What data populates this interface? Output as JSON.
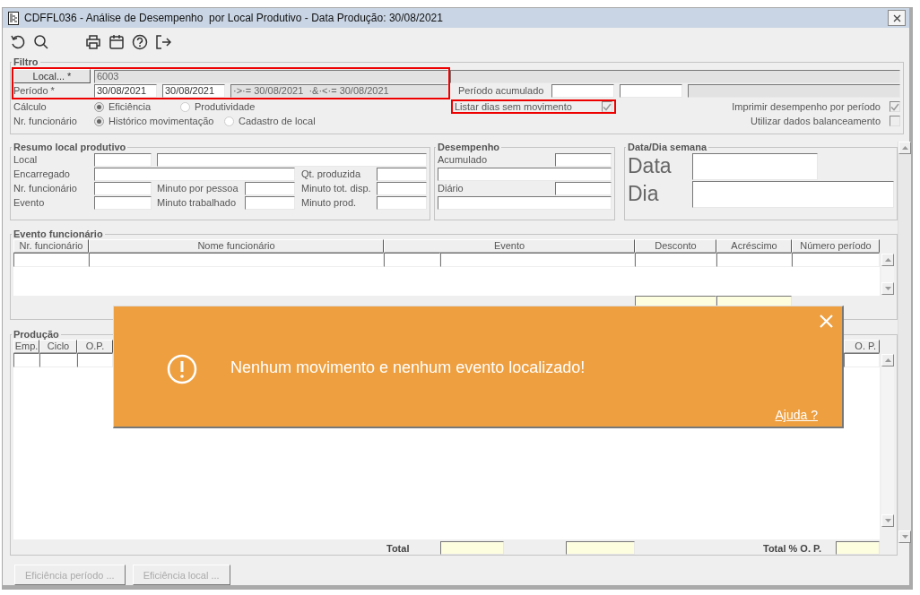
{
  "window": {
    "title": "CDFFL036 - Análise de Desempenho  por Local Produtivo - Data Produção: 30/08/2021"
  },
  "filter": {
    "title": "Filtro",
    "highlighted": true,
    "local_button": "Local... *",
    "local_value": "6003",
    "period_label": "Período *",
    "period_from": "30/08/2021",
    "period_to": "30/08/2021",
    "period_expression": "·>·= 30/08/2021  ·&·<·= 30/08/2021",
    "accumulated_label": "Período acumulado",
    "radio_groups": [
      {
        "label": "Cálculo",
        "options": [
          {
            "label": "Eficiência",
            "selected": true
          },
          {
            "label": "Produtividade",
            "selected": false
          }
        ]
      },
      {
        "label": "Nr. funcionário",
        "options": [
          {
            "label": "Histórico movimentação",
            "selected": true
          },
          {
            "label": "Cadastro de local",
            "selected": false
          }
        ]
      }
    ],
    "checkboxes": [
      {
        "label": "Listar dias sem movimento",
        "checked": true,
        "highlighted": true
      },
      {
        "label": "Imprimir desempenho por período",
        "checked": true,
        "highlighted": false
      },
      {
        "label": "Utilizar dados balanceamento",
        "checked": false,
        "highlighted": false
      }
    ]
  },
  "summary": {
    "title": "Resumo local produtivo",
    "labels": [
      "Local",
      "Encarregado",
      "Nr. funcionário",
      "Evento",
      "Minuto por pessoa",
      "Minuto trabalhado",
      "Qt. produzida",
      "Minuto tot. disp.",
      "Minuto prod."
    ]
  },
  "performance": {
    "title": "Desempenho",
    "labels": [
      "Acumulado",
      "Diário"
    ]
  },
  "date_panel": {
    "title": "Data/Dia semana",
    "labels": [
      "Data",
      "Dia"
    ]
  },
  "employee_events": {
    "title": "Evento funcionário",
    "columns": [
      "Nr. funcionário",
      "Nome funcionário",
      "Evento",
      "Desconto",
      "Acréscimo",
      "Número período"
    ]
  },
  "production": {
    "title": "Produção",
    "columns": [
      "Emp.",
      "Ciclo",
      "O.P.",
      "O. P."
    ],
    "total_label": "Total",
    "total_percent_label": "Total % O. P."
  },
  "buttons": [
    {
      "label": "Eficiência período ...",
      "disabled": true
    },
    {
      "label": "Eficiência local ...",
      "disabled": true
    }
  ],
  "toast": {
    "message": "Nenhum movimento e nenhum evento localizado!",
    "help_link": "Ajuda ?"
  }
}
